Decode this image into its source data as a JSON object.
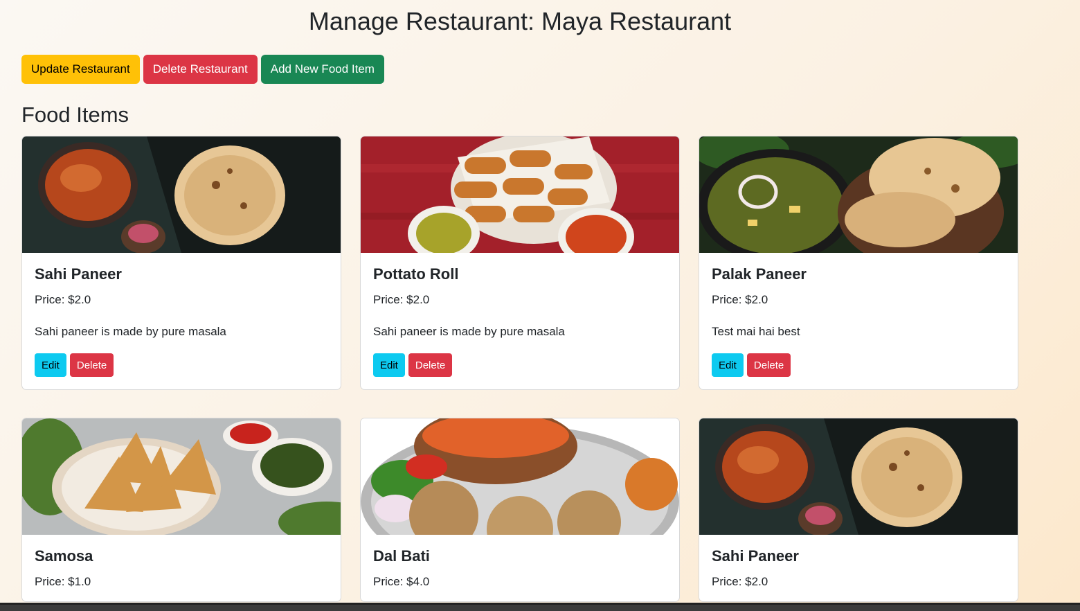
{
  "page": {
    "title": "Manage Restaurant: Maya Restaurant"
  },
  "actions": {
    "update_label": "Update Restaurant",
    "delete_label": "Delete Restaurant",
    "add_label": "Add New Food Item"
  },
  "section": {
    "title": "Food Items"
  },
  "cards": [
    {
      "name": "Sahi Paneer",
      "price": "Price: $2.0",
      "description": "Sahi paneer is made by pure masala",
      "edit": "Edit",
      "delete": "Delete",
      "image": "paneer-butter-masala-with-naan"
    },
    {
      "name": "Pottato Roll",
      "price": "Price: $2.0",
      "description": "Sahi paneer is made by pure masala",
      "edit": "Edit",
      "delete": "Delete",
      "image": "potato-rolls-with-dips"
    },
    {
      "name": "Palak Paneer",
      "price": "Price: $2.0",
      "description": "Test mai hai best",
      "edit": "Edit",
      "delete": "Delete",
      "image": "palak-paneer-with-naan"
    },
    {
      "name": "Samosa",
      "price": "Price: $1.0",
      "image": "samosa-with-chutney"
    },
    {
      "name": "Dal Bati",
      "price": "Price: $4.0",
      "image": "dal-bati-thali"
    },
    {
      "name": "Sahi Paneer",
      "price": "Price: $2.0",
      "image": "paneer-butter-masala-with-naan"
    }
  ],
  "colors": {
    "warning": "#ffc107",
    "danger": "#dc3545",
    "success": "#198754",
    "info": "#0dcaf0"
  }
}
